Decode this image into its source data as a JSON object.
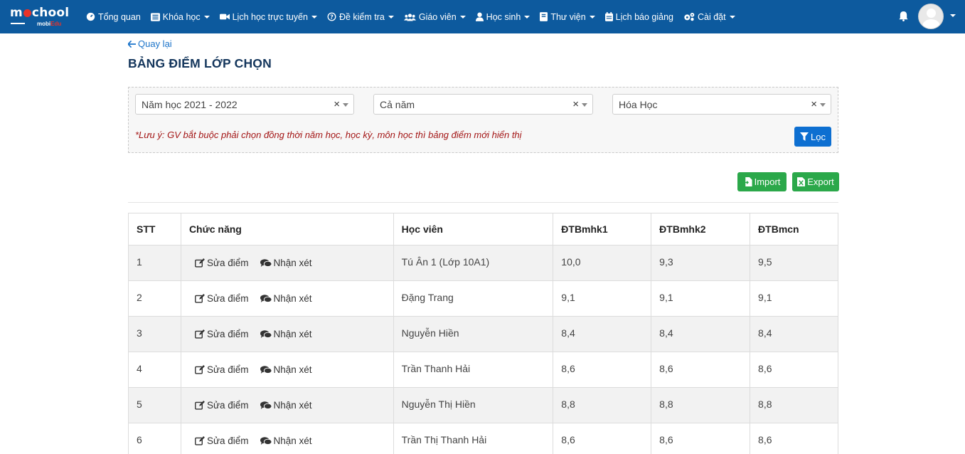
{
  "logo": {
    "text_a": "m",
    "text_b": "chool",
    "sub_a": "mobi",
    "sub_b": "Edu"
  },
  "nav": [
    {
      "label": "Tổng quan",
      "icon": "dashboard-icon",
      "caret": false
    },
    {
      "label": "Khóa học",
      "icon": "list-icon",
      "caret": true
    },
    {
      "label": "Lịch học trực tuyến",
      "icon": "video-icon",
      "caret": true
    },
    {
      "label": "Đề kiểm tra",
      "icon": "question-icon",
      "caret": true
    },
    {
      "label": "Giáo viên",
      "icon": "users-icon",
      "caret": true
    },
    {
      "label": "Học sinh",
      "icon": "user-icon",
      "caret": true
    },
    {
      "label": "Thư viện",
      "icon": "book-icon",
      "caret": true
    },
    {
      "label": "Lịch báo giảng",
      "icon": "calendar-icon",
      "caret": false
    },
    {
      "label": "Cài đặt",
      "icon": "gears-icon",
      "caret": true
    }
  ],
  "back_label": "Quay lại",
  "page_title": "BẢNG ĐIỂM LỚP CHỌN",
  "filters": {
    "year": "Năm học 2021 - 2022",
    "term": "Cả năm",
    "subject": "Hóa Học",
    "clear_symbol": "×",
    "note": "*Lưu ý: GV bắt buộc phải chọn đồng thời năm học, học kỳ, môn học thì bảng điểm mới hiển thị",
    "filter_label": "Lọc"
  },
  "import_label": "Import",
  "export_label": "Export",
  "table": {
    "headers": [
      "STT",
      "Chức năng",
      "Học viên",
      "ĐTBmhk1",
      "ĐTBmhk2",
      "ĐTBmcn"
    ],
    "edit_label": "Sửa điểm",
    "comment_label": "Nhận xét",
    "rows": [
      {
        "stt": "1",
        "name": "Tú Ân 1 (Lớp 10A1)",
        "hk1": "10,0",
        "hk2": "9,3",
        "cn": "9,5"
      },
      {
        "stt": "2",
        "name": "Đặng Trang",
        "hk1": "9,1",
        "hk2": "9,1",
        "cn": "9,1"
      },
      {
        "stt": "3",
        "name": "Nguyễn Hiền",
        "hk1": "8,4",
        "hk2": "8,4",
        "cn": "8,4"
      },
      {
        "stt": "4",
        "name": "Trần Thanh Hải",
        "hk1": "8,6",
        "hk2": "8,6",
        "cn": "8,6"
      },
      {
        "stt": "5",
        "name": "Nguyễn Thị Hiền",
        "hk1": "8,8",
        "hk2": "8,8",
        "cn": "8,8"
      },
      {
        "stt": "6",
        "name": "Trần Thị Thanh Hải",
        "hk1": "8,6",
        "hk2": "8,6",
        "cn": "8,6"
      }
    ]
  },
  "colors": {
    "navbar": "#0d5a9e",
    "accent": "#0d6fd1",
    "success": "#2ba84a",
    "note": "#a31515",
    "title": "#14365c"
  }
}
